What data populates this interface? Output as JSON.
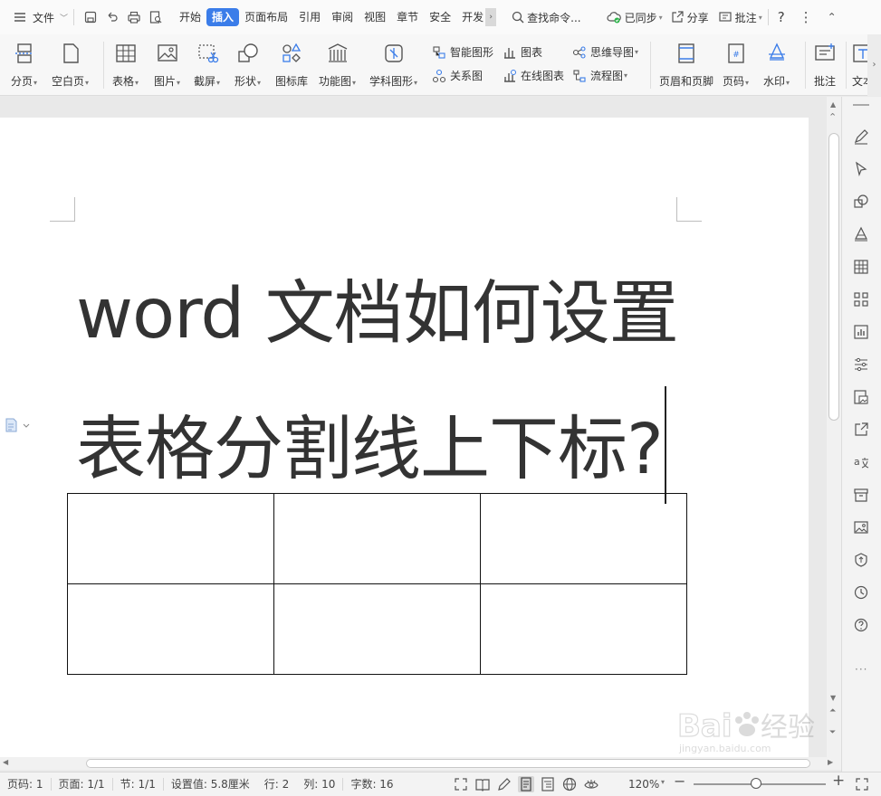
{
  "menubar": {
    "file_label": "文件",
    "tabs": [
      {
        "label": "开始",
        "active": false
      },
      {
        "label": "插入",
        "active": true
      },
      {
        "label": "页面布局",
        "active": false
      },
      {
        "label": "引用",
        "active": false
      },
      {
        "label": "审阅",
        "active": false
      },
      {
        "label": "视图",
        "active": false
      },
      {
        "label": "章节",
        "active": false
      },
      {
        "label": "安全",
        "active": false
      },
      {
        "label": "开发",
        "active": false
      }
    ],
    "search_label": "查找命令...",
    "sync_label": "已同步",
    "share_label": "分享",
    "comment_label": "批注"
  },
  "ribbon": {
    "page_break": "分页",
    "blank_page": "空白页",
    "table": "表格",
    "picture": "图片",
    "screenshot": "截屏",
    "shape": "形状",
    "icon_lib": "图标库",
    "function_chart": "功能图",
    "science_shape": "学科图形",
    "smart_shape": "智能图形",
    "chart": "图表",
    "mindmap": "思维导图",
    "relation": "关系图",
    "online_chart": "在线图表",
    "flowchart": "流程图",
    "header_footer": "页眉和页脚",
    "page_number": "页码",
    "watermark": "水印",
    "comment": "批注",
    "textbox": "文本"
  },
  "document": {
    "title_line1": "word 文档如何设置",
    "title_line2": "表格分割线上下标?",
    "table_rows": 2,
    "table_cols": 3
  },
  "statusbar": {
    "page_num": "页码: 1",
    "page_count": "页面: 1/1",
    "section": "节: 1/1",
    "setting": "设置值: 5.8厘米",
    "row": "行: 2",
    "col": "列: 10",
    "word_count": "字数: 16",
    "zoom": "120%",
    "zoom_level": 0.47
  },
  "watermark": {
    "brand": "Bai",
    "brand2": "du",
    "cn": "经验",
    "url": "jingyan.baidu.com"
  },
  "colors": {
    "accent": "#3b7de9",
    "text": "#333333"
  }
}
